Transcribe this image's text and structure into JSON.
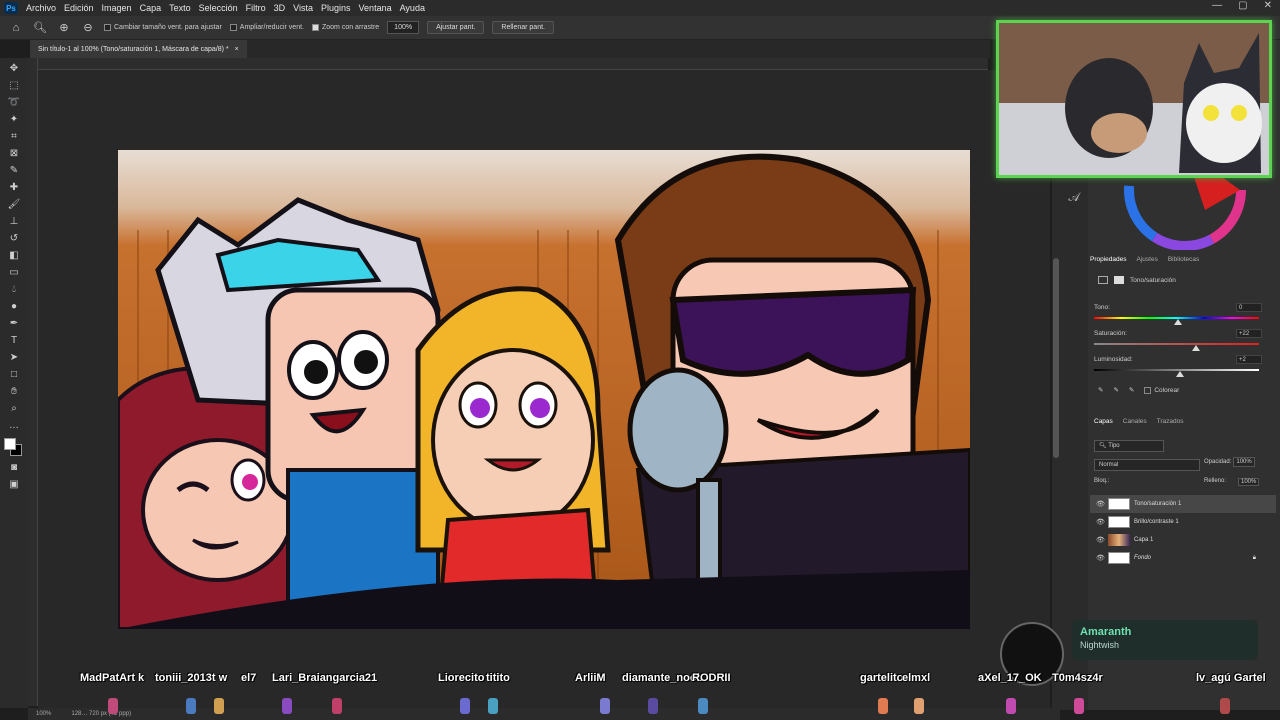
{
  "menubar": {
    "logo": "Ps",
    "items": [
      "Archivo",
      "Edición",
      "Imagen",
      "Capa",
      "Texto",
      "Selección",
      "Filtro",
      "3D",
      "Vista",
      "Plugins",
      "Ventana",
      "Ayuda"
    ],
    "window_controls": [
      "—",
      "▢",
      "✕"
    ]
  },
  "options": {
    "resize_windows": "Cambiar tamaño vent. para ajustar",
    "zoom_all": "Ampliar/reducir vent.",
    "scrubby_zoom": "Zoom con arrastre",
    "zoom_value": "100%",
    "fit_screen": "Ajustar pant.",
    "fill_screen": "Rellenar pant."
  },
  "document": {
    "tab_title": "Sin título-1 al 100% (Tono/saturación 1, Máscara de capa/8) *",
    "tab_close": "×"
  },
  "statusbar": {
    "zoom": "100%",
    "doc_info": "128… 720 px (72 ppp)"
  },
  "properties": {
    "tabs": [
      "Propiedades",
      "Ajustes",
      "Bibliotecas"
    ],
    "adjustment_name": "Tono/saturación",
    "hue_label": "Tono:",
    "hue_value": "0",
    "saturation_label": "Saturación:",
    "saturation_value": "+22",
    "lightness_label": "Luminosidad:",
    "lightness_value": "+2",
    "colorize_label": "Colorear"
  },
  "layers_panel": {
    "tabs": [
      "Capas",
      "Canales",
      "Trazados"
    ],
    "filter_kind": "Tipo",
    "blend_mode": "Normal",
    "opacity_label": "Opacidad:",
    "opacity_value": "100%",
    "lock_label": "Bloq.:",
    "fill_label": "Relleno:",
    "fill_value": "100%",
    "layers": [
      {
        "name": "Tono/saturación 1",
        "selected": true
      },
      {
        "name": "Brillo/contraste 1",
        "selected": false
      },
      {
        "name": "Capa 1",
        "selected": false
      },
      {
        "name": "Fondo",
        "selected": false
      }
    ]
  },
  "stream_overlay": {
    "alert_title": "Amaranth",
    "alert_subtitle": "Nightwish",
    "chat_usernames": [
      "MadPatArt k",
      "toniii_2013t w",
      "el7",
      "Lari_Braiangarcia21",
      "Liorecito",
      "titito",
      "ArliiM",
      "diamante_noob",
      "RODRII",
      "gartelito",
      "elmxl",
      "aXel_17_OK",
      "T0m4sz4r",
      "lv_agú Gartel"
    ]
  },
  "colors": {
    "app_bg": "#1e1e1e",
    "panel_bg": "#303030",
    "accent_green": "#5bd44f"
  }
}
